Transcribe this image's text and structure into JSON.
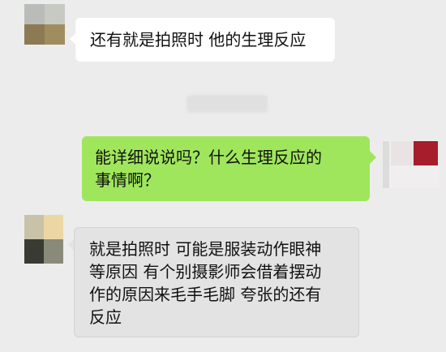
{
  "messages": [
    {
      "direction": "incoming",
      "lines": [
        "还有就是拍照时 他的生理反应"
      ]
    },
    {
      "direction": "outgoing",
      "lines": [
        "能详细说说吗？什么生理反应的",
        "事情啊？"
      ]
    },
    {
      "direction": "incoming",
      "lines": [
        "就是拍照时 可能是服装动作眼神",
        "等原因 有个别摄影师会借着摆动",
        "作的原因来毛手毛脚 夸张的还有",
        "反应"
      ]
    }
  ],
  "colors": {
    "background": "#ececec",
    "incoming_bubble": "#ffffff",
    "outgoing_bubble": "#9fe65c",
    "quoted_bubble": "#e3e3e3"
  }
}
